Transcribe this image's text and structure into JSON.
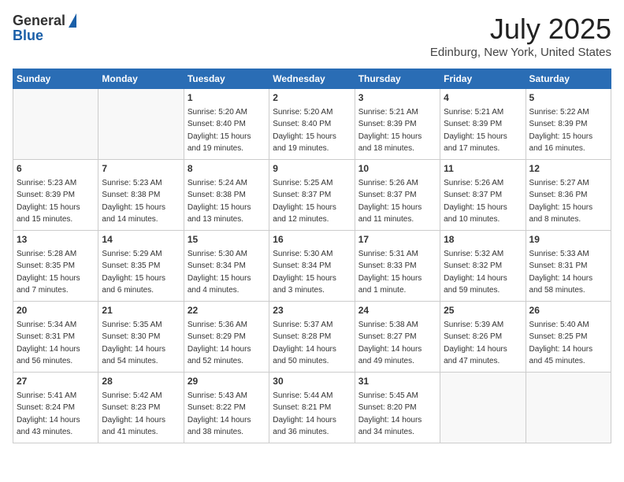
{
  "header": {
    "logo_general": "General",
    "logo_blue": "Blue",
    "title": "July 2025",
    "subtitle": "Edinburg, New York, United States"
  },
  "weekdays": [
    "Sunday",
    "Monday",
    "Tuesday",
    "Wednesday",
    "Thursday",
    "Friday",
    "Saturday"
  ],
  "weeks": [
    [
      {
        "day": "",
        "sunrise": "",
        "sunset": "",
        "daylight": ""
      },
      {
        "day": "",
        "sunrise": "",
        "sunset": "",
        "daylight": ""
      },
      {
        "day": "1",
        "sunrise": "Sunrise: 5:20 AM",
        "sunset": "Sunset: 8:40 PM",
        "daylight": "Daylight: 15 hours and 19 minutes."
      },
      {
        "day": "2",
        "sunrise": "Sunrise: 5:20 AM",
        "sunset": "Sunset: 8:40 PM",
        "daylight": "Daylight: 15 hours and 19 minutes."
      },
      {
        "day": "3",
        "sunrise": "Sunrise: 5:21 AM",
        "sunset": "Sunset: 8:39 PM",
        "daylight": "Daylight: 15 hours and 18 minutes."
      },
      {
        "day": "4",
        "sunrise": "Sunrise: 5:21 AM",
        "sunset": "Sunset: 8:39 PM",
        "daylight": "Daylight: 15 hours and 17 minutes."
      },
      {
        "day": "5",
        "sunrise": "Sunrise: 5:22 AM",
        "sunset": "Sunset: 8:39 PM",
        "daylight": "Daylight: 15 hours and 16 minutes."
      }
    ],
    [
      {
        "day": "6",
        "sunrise": "Sunrise: 5:23 AM",
        "sunset": "Sunset: 8:39 PM",
        "daylight": "Daylight: 15 hours and 15 minutes."
      },
      {
        "day": "7",
        "sunrise": "Sunrise: 5:23 AM",
        "sunset": "Sunset: 8:38 PM",
        "daylight": "Daylight: 15 hours and 14 minutes."
      },
      {
        "day": "8",
        "sunrise": "Sunrise: 5:24 AM",
        "sunset": "Sunset: 8:38 PM",
        "daylight": "Daylight: 15 hours and 13 minutes."
      },
      {
        "day": "9",
        "sunrise": "Sunrise: 5:25 AM",
        "sunset": "Sunset: 8:37 PM",
        "daylight": "Daylight: 15 hours and 12 minutes."
      },
      {
        "day": "10",
        "sunrise": "Sunrise: 5:26 AM",
        "sunset": "Sunset: 8:37 PM",
        "daylight": "Daylight: 15 hours and 11 minutes."
      },
      {
        "day": "11",
        "sunrise": "Sunrise: 5:26 AM",
        "sunset": "Sunset: 8:37 PM",
        "daylight": "Daylight: 15 hours and 10 minutes."
      },
      {
        "day": "12",
        "sunrise": "Sunrise: 5:27 AM",
        "sunset": "Sunset: 8:36 PM",
        "daylight": "Daylight: 15 hours and 8 minutes."
      }
    ],
    [
      {
        "day": "13",
        "sunrise": "Sunrise: 5:28 AM",
        "sunset": "Sunset: 8:35 PM",
        "daylight": "Daylight: 15 hours and 7 minutes."
      },
      {
        "day": "14",
        "sunrise": "Sunrise: 5:29 AM",
        "sunset": "Sunset: 8:35 PM",
        "daylight": "Daylight: 15 hours and 6 minutes."
      },
      {
        "day": "15",
        "sunrise": "Sunrise: 5:30 AM",
        "sunset": "Sunset: 8:34 PM",
        "daylight": "Daylight: 15 hours and 4 minutes."
      },
      {
        "day": "16",
        "sunrise": "Sunrise: 5:30 AM",
        "sunset": "Sunset: 8:34 PM",
        "daylight": "Daylight: 15 hours and 3 minutes."
      },
      {
        "day": "17",
        "sunrise": "Sunrise: 5:31 AM",
        "sunset": "Sunset: 8:33 PM",
        "daylight": "Daylight: 15 hours and 1 minute."
      },
      {
        "day": "18",
        "sunrise": "Sunrise: 5:32 AM",
        "sunset": "Sunset: 8:32 PM",
        "daylight": "Daylight: 14 hours and 59 minutes."
      },
      {
        "day": "19",
        "sunrise": "Sunrise: 5:33 AM",
        "sunset": "Sunset: 8:31 PM",
        "daylight": "Daylight: 14 hours and 58 minutes."
      }
    ],
    [
      {
        "day": "20",
        "sunrise": "Sunrise: 5:34 AM",
        "sunset": "Sunset: 8:31 PM",
        "daylight": "Daylight: 14 hours and 56 minutes."
      },
      {
        "day": "21",
        "sunrise": "Sunrise: 5:35 AM",
        "sunset": "Sunset: 8:30 PM",
        "daylight": "Daylight: 14 hours and 54 minutes."
      },
      {
        "day": "22",
        "sunrise": "Sunrise: 5:36 AM",
        "sunset": "Sunset: 8:29 PM",
        "daylight": "Daylight: 14 hours and 52 minutes."
      },
      {
        "day": "23",
        "sunrise": "Sunrise: 5:37 AM",
        "sunset": "Sunset: 8:28 PM",
        "daylight": "Daylight: 14 hours and 50 minutes."
      },
      {
        "day": "24",
        "sunrise": "Sunrise: 5:38 AM",
        "sunset": "Sunset: 8:27 PM",
        "daylight": "Daylight: 14 hours and 49 minutes."
      },
      {
        "day": "25",
        "sunrise": "Sunrise: 5:39 AM",
        "sunset": "Sunset: 8:26 PM",
        "daylight": "Daylight: 14 hours and 47 minutes."
      },
      {
        "day": "26",
        "sunrise": "Sunrise: 5:40 AM",
        "sunset": "Sunset: 8:25 PM",
        "daylight": "Daylight: 14 hours and 45 minutes."
      }
    ],
    [
      {
        "day": "27",
        "sunrise": "Sunrise: 5:41 AM",
        "sunset": "Sunset: 8:24 PM",
        "daylight": "Daylight: 14 hours and 43 minutes."
      },
      {
        "day": "28",
        "sunrise": "Sunrise: 5:42 AM",
        "sunset": "Sunset: 8:23 PM",
        "daylight": "Daylight: 14 hours and 41 minutes."
      },
      {
        "day": "29",
        "sunrise": "Sunrise: 5:43 AM",
        "sunset": "Sunset: 8:22 PM",
        "daylight": "Daylight: 14 hours and 38 minutes."
      },
      {
        "day": "30",
        "sunrise": "Sunrise: 5:44 AM",
        "sunset": "Sunset: 8:21 PM",
        "daylight": "Daylight: 14 hours and 36 minutes."
      },
      {
        "day": "31",
        "sunrise": "Sunrise: 5:45 AM",
        "sunset": "Sunset: 8:20 PM",
        "daylight": "Daylight: 14 hours and 34 minutes."
      },
      {
        "day": "",
        "sunrise": "",
        "sunset": "",
        "daylight": ""
      },
      {
        "day": "",
        "sunrise": "",
        "sunset": "",
        "daylight": ""
      }
    ]
  ]
}
